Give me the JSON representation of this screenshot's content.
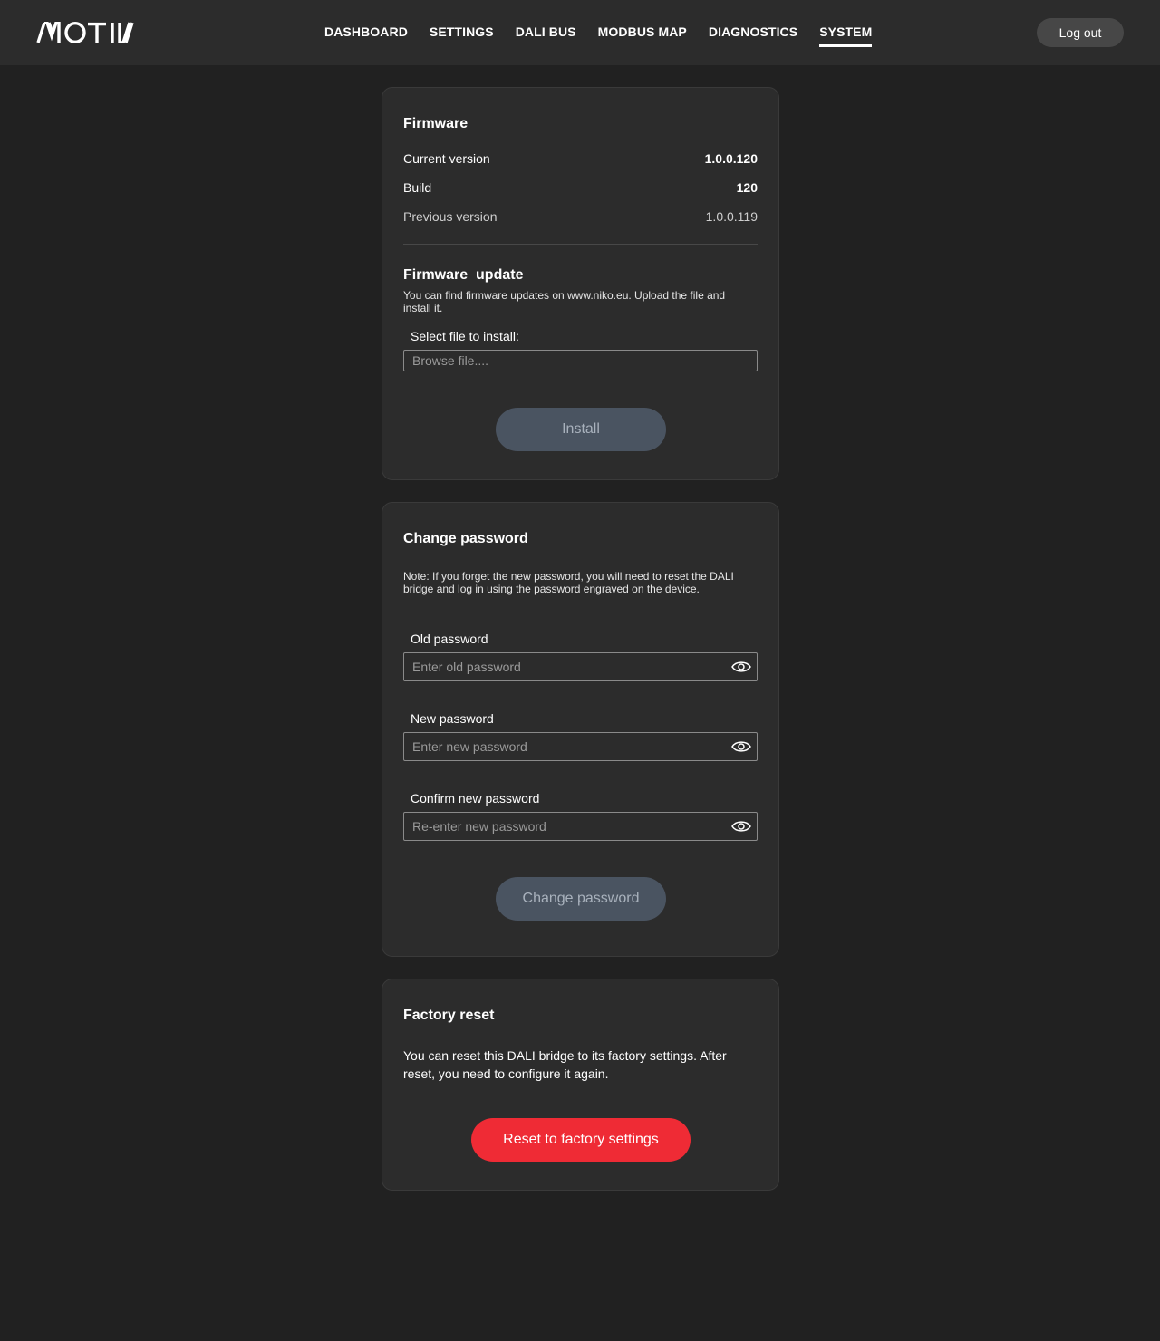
{
  "brand": {
    "logo_text": "MOTIV"
  },
  "nav": {
    "items": [
      {
        "label": "DASHBOARD"
      },
      {
        "label": "SETTINGS"
      },
      {
        "label": "DALI BUS"
      },
      {
        "label": "MODBUS MAP"
      },
      {
        "label": "DIAGNOSTICS"
      },
      {
        "label": "SYSTEM",
        "active": true
      }
    ],
    "logout_label": "Log out"
  },
  "firmware": {
    "title": "Firmware",
    "current_version_label": "Current version",
    "current_version_value": "1.0.0.120",
    "build_label": "Build",
    "build_value": "120",
    "previous_version_label": "Previous version",
    "previous_version_value": "1.0.0.119"
  },
  "firmware_update": {
    "title": "Firmware  update",
    "description": "You can find firmware updates on www.niko.eu.  Upload the file and install it.",
    "select_label": "Select file to install:",
    "browse_placeholder": "Browse file....",
    "install_label": "Install"
  },
  "change_password": {
    "title": "Change password",
    "note": "Note: If you forget the new password, you will need to reset the DALI bridge and log in using the password engraved on the device.",
    "old_label": "Old password",
    "old_placeholder": "Enter old password",
    "new_label": "New password",
    "new_placeholder": "Enter new password",
    "confirm_label": "Confirm new password",
    "confirm_placeholder": "Re-enter new password",
    "button_label": "Change password"
  },
  "factory_reset": {
    "title": "Factory reset",
    "description": "You can reset this DALI bridge to its factory settings. After reset, you need to configure it again.",
    "button_label": "Reset to factory settings"
  },
  "colors": {
    "background": "#212121",
    "card": "#2c2c2c",
    "disabled_button": "#4a5461",
    "danger_button": "#ef2b35"
  }
}
